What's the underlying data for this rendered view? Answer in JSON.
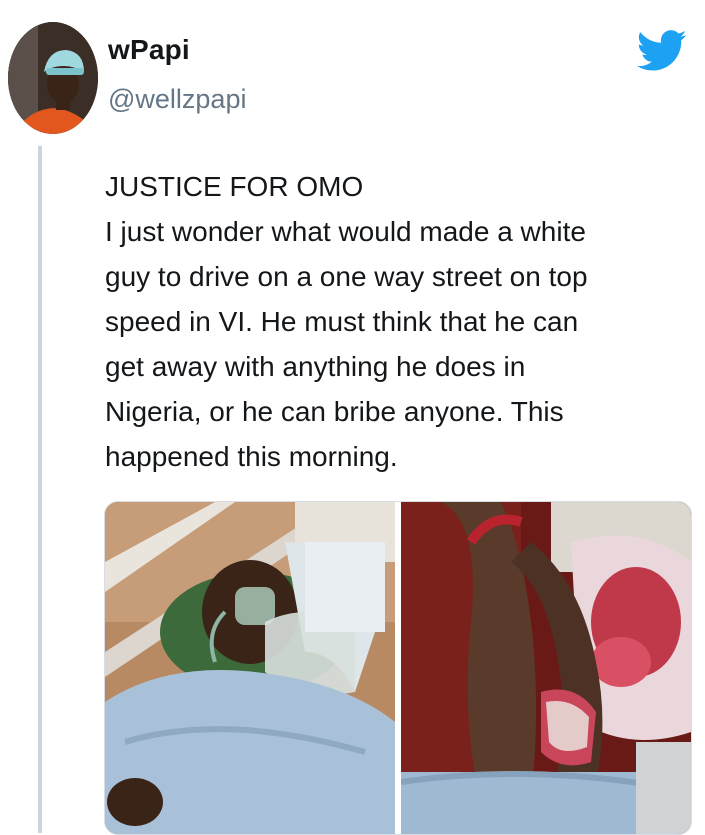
{
  "tweet": {
    "author": {
      "display_name": "wPapi",
      "handle": "@wellzpapi",
      "avatar_icon": "profile-photo"
    },
    "platform_icon": "twitter-bird-icon",
    "text_lines": [
      "JUSTICE FOR OMO",
      "I just wonder what would made a white",
      "guy to drive on a one way street on top",
      "speed in VI. He must think that he can",
      "get away with anything he does in",
      "Nigeria, or he can bribe anyone. This",
      "happened this morning."
    ],
    "media_count": 2
  },
  "colors": {
    "twitter_blue": "#1da1f2",
    "text": "#14171a",
    "secondary_text": "#657786",
    "thread_line": "#ccd6dd"
  }
}
